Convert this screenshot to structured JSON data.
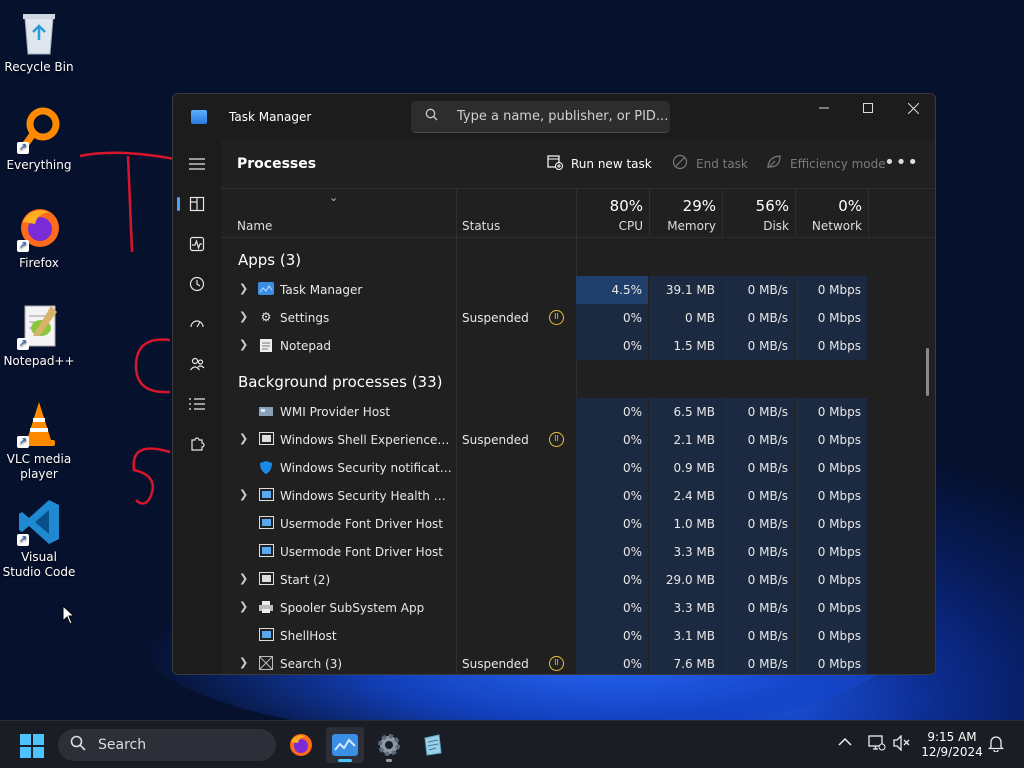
{
  "desktop": {
    "icons": [
      {
        "label": "Recycle Bin"
      },
      {
        "label": "Everything"
      },
      {
        "label": "Firefox"
      },
      {
        "label": "Notepad++"
      },
      {
        "label": "VLC media player"
      },
      {
        "label": "Visual Studio Code"
      }
    ]
  },
  "window": {
    "title": "Task Manager",
    "search_placeholder": "Type a name, publisher, or PID...",
    "page_title": "Processes",
    "toolbar": {
      "run_new_task": "Run new task",
      "end_task": "End task",
      "efficiency_mode": "Efficiency mode"
    },
    "columns": {
      "name": "Name",
      "status": "Status",
      "cpu": {
        "pct": "80%",
        "label": "CPU"
      },
      "memory": {
        "pct": "29%",
        "label": "Memory"
      },
      "disk": {
        "pct": "56%",
        "label": "Disk"
      },
      "network": {
        "pct": "0%",
        "label": "Network"
      }
    },
    "groups": {
      "apps": "Apps (3)",
      "background": "Background processes (33)"
    },
    "apps": [
      {
        "name": "Task Manager",
        "status": "",
        "cpu": "4.5%",
        "memory": "39.1 MB",
        "disk": "0 MB/s",
        "network": "0 Mbps"
      },
      {
        "name": "Settings",
        "status": "Suspended",
        "cpu": "0%",
        "memory": "0 MB",
        "disk": "0 MB/s",
        "network": "0 Mbps"
      },
      {
        "name": "Notepad",
        "status": "",
        "cpu": "0%",
        "memory": "1.5 MB",
        "disk": "0 MB/s",
        "network": "0 Mbps"
      }
    ],
    "background": [
      {
        "name": "WMI Provider Host",
        "status": "",
        "cpu": "0%",
        "memory": "6.5 MB",
        "disk": "0 MB/s",
        "network": "0 Mbps"
      },
      {
        "name": "Windows Shell Experience Host",
        "status": "Suspended",
        "cpu": "0%",
        "memory": "2.1 MB",
        "disk": "0 MB/s",
        "network": "0 Mbps"
      },
      {
        "name": "Windows Security notification icon",
        "status": "",
        "cpu": "0%",
        "memory": "0.9 MB",
        "disk": "0 MB/s",
        "network": "0 Mbps"
      },
      {
        "name": "Windows Security Health Service",
        "status": "",
        "cpu": "0%",
        "memory": "2.4 MB",
        "disk": "0 MB/s",
        "network": "0 Mbps"
      },
      {
        "name": "Usermode Font Driver Host",
        "status": "",
        "cpu": "0%",
        "memory": "1.0 MB",
        "disk": "0 MB/s",
        "network": "0 Mbps"
      },
      {
        "name": "Usermode Font Driver Host",
        "status": "",
        "cpu": "0%",
        "memory": "3.3 MB",
        "disk": "0 MB/s",
        "network": "0 Mbps"
      },
      {
        "name": "Start (2)",
        "status": "",
        "cpu": "0%",
        "memory": "29.0 MB",
        "disk": "0 MB/s",
        "network": "0 Mbps"
      },
      {
        "name": "Spooler SubSystem App",
        "status": "",
        "cpu": "0%",
        "memory": "3.3 MB",
        "disk": "0 MB/s",
        "network": "0 Mbps"
      },
      {
        "name": "ShellHost",
        "status": "",
        "cpu": "0%",
        "memory": "3.1 MB",
        "disk": "0 MB/s",
        "network": "0 Mbps"
      },
      {
        "name": "Search (3)",
        "status": "Suspended",
        "cpu": "0%",
        "memory": "7.6 MB",
        "disk": "0 MB/s",
        "network": "0 Mbps"
      }
    ]
  },
  "taskbar": {
    "search_label": "Search",
    "time": "9:15 AM",
    "date": "12/9/2024"
  },
  "colors": {
    "accent": "#4cc2ff",
    "suspended": "#e8c33a",
    "cpu_hot": "#203f6b",
    "cell": "#1b2a40"
  }
}
